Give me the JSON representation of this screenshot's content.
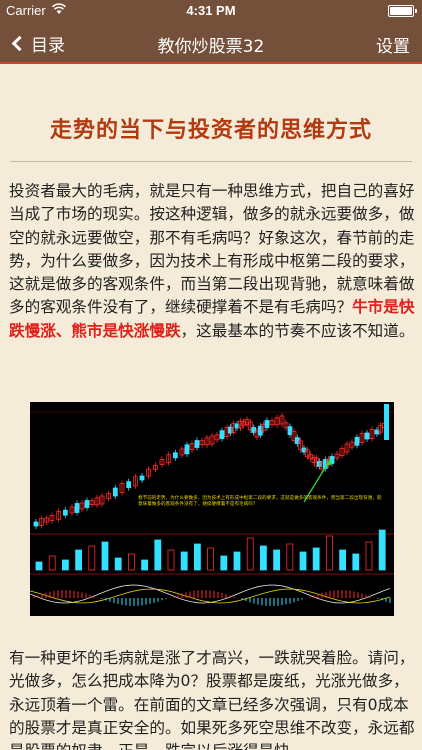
{
  "status_bar": {
    "carrier": "Carrier",
    "time": "4:31 PM"
  },
  "nav": {
    "back_label": "目录",
    "title": "教你炒股票32",
    "settings_label": "设置"
  },
  "article": {
    "title": "走势的当下与投资者的思维方式",
    "para1_pre": "投资者最大的毛病，就是只有一种思维方式，把自己的喜好当成了市场的现实。按这种逻辑，做多的就永远要做多，做空的就永远要做空，那不有毛病吗？好象这次，春节前的走势，为什么要做多，因为技术上有形成中枢第二段的要求，这就是做多的客观条件，而当第二段出现背驰，就意味着做多的客观条件没有了，继续硬撑着不是有毛病吗？",
    "para1_highlight": "牛市是快跌慢涨、熊市是快涨慢跌",
    "para1_post": "，这最基本的节奏不应该不知道。",
    "para2": "有一种更坏的毛病就是涨了才高兴，一跌就哭着脸。请问，光做多，怎么把成本降为0？股票都是废纸，光涨光做多，永远顶着一个雷。在前面的文章已经多次强调，只有0成本的股票才是真正安全的。如果死多死空思维不改变，永远都是股票的奴隶。正是，跌完以后涨得是快"
  },
  "chart_image": {
    "note": "春节前的走势，为什么要做多，因为技术上有形成中枢第二段的要求，这就是做多的客观条件，而当第二段出现背驰，就意味着做多的客观条件没有了，继续硬撑着不是有毛病吗？",
    "colors": {
      "up": "#ff2a2a",
      "down": "#33e0ff",
      "bg": "#000000",
      "arrow": "#2ee02e"
    }
  }
}
